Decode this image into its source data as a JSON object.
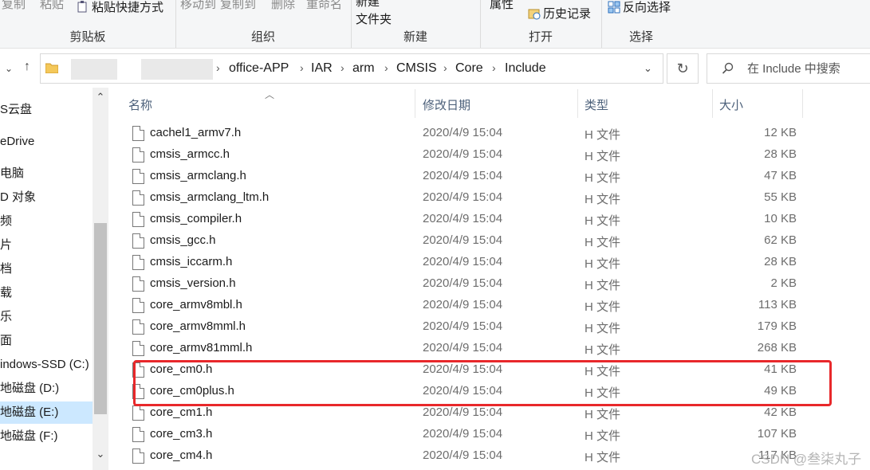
{
  "ribbon": {
    "groups": [
      {
        "label": "剪贴板"
      },
      {
        "label": "组织"
      },
      {
        "label": "新建"
      },
      {
        "label": "打开"
      },
      {
        "label": "选择"
      }
    ],
    "buttons": {
      "copy": "复制",
      "paste": "粘贴",
      "paste_shortcut": "粘贴快捷方式",
      "move_to": "移动到",
      "copy_to": "复制到",
      "delete": "删除",
      "rename": "重命名",
      "new_folder": "新建\n文件夹",
      "properties": "属性",
      "history": "历史记录",
      "invert_select": "反向选择"
    }
  },
  "address": {
    "crumbs": [
      "office-APP",
      "IAR",
      "arm",
      "CMSIS",
      "Core",
      "Include"
    ]
  },
  "search": {
    "placeholder": "在 Include 中搜索"
  },
  "sidebar": {
    "items": [
      {
        "label": "S云盘"
      },
      {
        "label": "eDrive"
      },
      {
        "label": "电脑"
      },
      {
        "label": "D 对象"
      },
      {
        "label": "频"
      },
      {
        "label": "片"
      },
      {
        "label": "档"
      },
      {
        "label": "载"
      },
      {
        "label": "乐"
      },
      {
        "label": "面"
      },
      {
        "label": "indows-SSD (C:)"
      },
      {
        "label": "地磁盘 (D:)"
      },
      {
        "label": "地磁盘 (E:)"
      },
      {
        "label": "地磁盘 (F:)"
      }
    ]
  },
  "columns": {
    "name": "名称",
    "date": "修改日期",
    "type": "类型",
    "size": "大小"
  },
  "files": [
    {
      "name": "cachel1_armv7.h",
      "date": "2020/4/9 15:04",
      "type": "H 文件",
      "size": "12 KB"
    },
    {
      "name": "cmsis_armcc.h",
      "date": "2020/4/9 15:04",
      "type": "H 文件",
      "size": "28 KB"
    },
    {
      "name": "cmsis_armclang.h",
      "date": "2020/4/9 15:04",
      "type": "H 文件",
      "size": "47 KB"
    },
    {
      "name": "cmsis_armclang_ltm.h",
      "date": "2020/4/9 15:04",
      "type": "H 文件",
      "size": "55 KB"
    },
    {
      "name": "cmsis_compiler.h",
      "date": "2020/4/9 15:04",
      "type": "H 文件",
      "size": "10 KB"
    },
    {
      "name": "cmsis_gcc.h",
      "date": "2020/4/9 15:04",
      "type": "H 文件",
      "size": "62 KB"
    },
    {
      "name": "cmsis_iccarm.h",
      "date": "2020/4/9 15:04",
      "type": "H 文件",
      "size": "28 KB"
    },
    {
      "name": "cmsis_version.h",
      "date": "2020/4/9 15:04",
      "type": "H 文件",
      "size": "2 KB"
    },
    {
      "name": "core_armv8mbl.h",
      "date": "2020/4/9 15:04",
      "type": "H 文件",
      "size": "113 KB"
    },
    {
      "name": "core_armv8mml.h",
      "date": "2020/4/9 15:04",
      "type": "H 文件",
      "size": "179 KB"
    },
    {
      "name": "core_armv81mml.h",
      "date": "2020/4/9 15:04",
      "type": "H 文件",
      "size": "268 KB"
    },
    {
      "name": "core_cm0.h",
      "date": "2020/4/9 15:04",
      "type": "H 文件",
      "size": "41 KB"
    },
    {
      "name": "core_cm0plus.h",
      "date": "2020/4/9 15:04",
      "type": "H 文件",
      "size": "49 KB"
    },
    {
      "name": "core_cm1.h",
      "date": "2020/4/9 15:04",
      "type": "H 文件",
      "size": "42 KB"
    },
    {
      "name": "core_cm3.h",
      "date": "2020/4/9 15:04",
      "type": "H 文件",
      "size": "107 KB"
    },
    {
      "name": "core_cm4.h",
      "date": "2020/4/9 15:04",
      "type": "H 文件",
      "size": "117 KB"
    }
  ],
  "watermark": "CSDN @叁柒丸子",
  "colors": {
    "highlight": "#e8282b",
    "selected": "#cce8ff",
    "header_text": "#4c607a"
  }
}
